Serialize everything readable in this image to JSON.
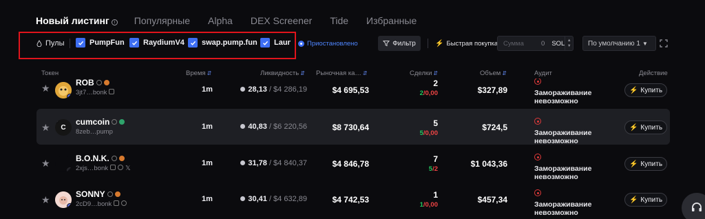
{
  "tabs": [
    {
      "label": "Новый листинг",
      "active": true
    },
    {
      "label": "Популярные"
    },
    {
      "label": "Alpha"
    },
    {
      "label": "DEX Screener"
    },
    {
      "label": "Tide"
    },
    {
      "label": "Избранные"
    }
  ],
  "filters": {
    "pools_label": "Пулы",
    "pools": [
      "PumpFun",
      "RaydiumV4",
      "swap.pump.fun",
      "Laun"
    ],
    "status": "Приостановлено",
    "filter_button": "Фильтр",
    "fast_buy_label": "Быстрая покупка",
    "amount_placeholder": "Сумма",
    "amount_value": "0",
    "amount_currency": "SOL",
    "sort_label": "По умолчанию 1"
  },
  "table": {
    "headers": {
      "token": "Токен",
      "time": "Время",
      "liquidity": "Ликвидность",
      "mcap": "Рыночная ка…",
      "trades": "Сделки",
      "volume": "Объем",
      "audit": "Аудит",
      "action": "Действие"
    },
    "buy_label": "Купить",
    "rows": [
      {
        "name": "ROB",
        "addr": "3jt7…bonk",
        "time": "1m",
        "liq_sol": "28,13",
        "liq_usd": "/ $4 286,19",
        "mcap": "$4 695,53",
        "trades": "2",
        "buys": "2",
        "sells": "0,00",
        "volume": "$327,89",
        "audit": "Замораживание невозможно",
        "avatar_color": "#e0a63a",
        "avatar_text": ""
      },
      {
        "name": "cumcoin",
        "addr": "8zeb…pump",
        "time": "1m",
        "liq_sol": "40,83",
        "liq_usd": "/ $6 220,56",
        "mcap": "$8 730,64",
        "trades": "5",
        "buys": "5",
        "sells": "0,00",
        "volume": "$724,5",
        "audit": "Замораживание невозможно",
        "avatar_color": "#151515",
        "avatar_text": "C"
      },
      {
        "name": "B.O.N.K.",
        "addr": "2xjs…bonk",
        "time": "1m",
        "liq_sol": "31,78",
        "liq_usd": "/ $4 840,37",
        "mcap": "$4 846,78",
        "trades": "7",
        "buys": "5",
        "sells": "2",
        "volume": "$1 043,36",
        "audit": "Замораживание невозможно",
        "avatar_color": "#0b0b0e",
        "avatar_text": ""
      },
      {
        "name": "SONNY",
        "addr": "2cD9…bonk",
        "time": "1m",
        "liq_sol": "30,41",
        "liq_usd": "/ $4 632,89",
        "mcap": "$4 742,53",
        "trades": "1",
        "buys": "1",
        "sells": "0,00",
        "volume": "$457,34",
        "audit": "Замораживание невозможно",
        "avatar_color": "#f3d9d2",
        "avatar_text": ""
      }
    ]
  },
  "colors": {
    "accent": "#3d6ef2",
    "buy": "#22c55e",
    "sell": "#ef4444",
    "highlight_box": "#e0141c"
  },
  "icons": [
    "info-icon",
    "drop-icon",
    "checkbox-checked-icon",
    "funnel-icon",
    "bolt-icon",
    "expand-icon",
    "star-icon",
    "sol-icon",
    "audit-warning-icon",
    "headset-icon"
  ]
}
